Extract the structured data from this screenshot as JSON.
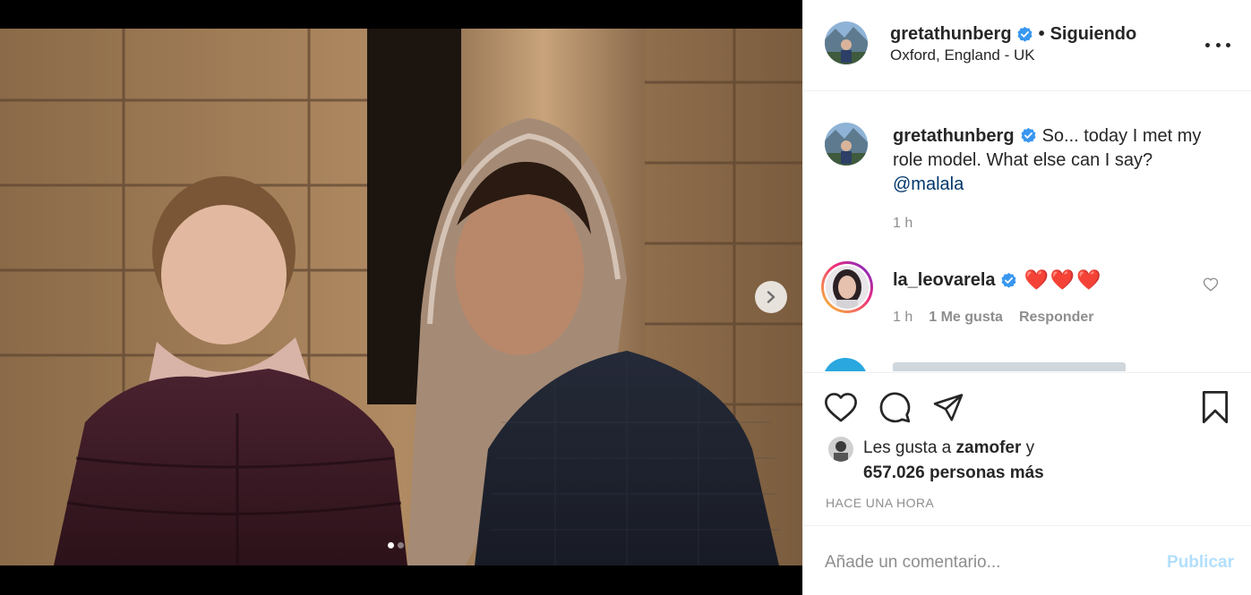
{
  "post": {
    "author": "gretathunberg",
    "follow_state": "Siguiendo",
    "separator": "•",
    "location": "Oxford, England - UK",
    "verified_icon": "verified-badge-icon",
    "image_count": 2,
    "active_image": 1
  },
  "caption": {
    "username": "gretathunberg",
    "text": "So... today I met my role model. What else can I say?",
    "mention": "@malala",
    "time": "1 h"
  },
  "comments": [
    {
      "username": "la_leovarela",
      "hearts": "❤️❤️❤️",
      "time": "1 h",
      "likes": "1 Me gusta",
      "reply_label": "Responder"
    }
  ],
  "likes": {
    "prefix": "Les gusta a",
    "user": "zamofer",
    "connector": "y",
    "count_text": "657.026 personas más"
  },
  "time_ago": "HACE UNA HORA",
  "add_comment": {
    "placeholder": "Añade un comentario...",
    "post_label": "Publicar"
  },
  "icons": {
    "like": "heart-icon",
    "comment": "comment-icon",
    "share": "paper-plane-icon",
    "save": "bookmark-icon",
    "more": "more-options-icon",
    "next": "chevron-right-icon"
  },
  "colors": {
    "verified": "#3897f0",
    "link": "#00376b",
    "muted": "#8e8e8e",
    "post_button_disabled": "#b2dffc",
    "heart": "#e0245e"
  }
}
